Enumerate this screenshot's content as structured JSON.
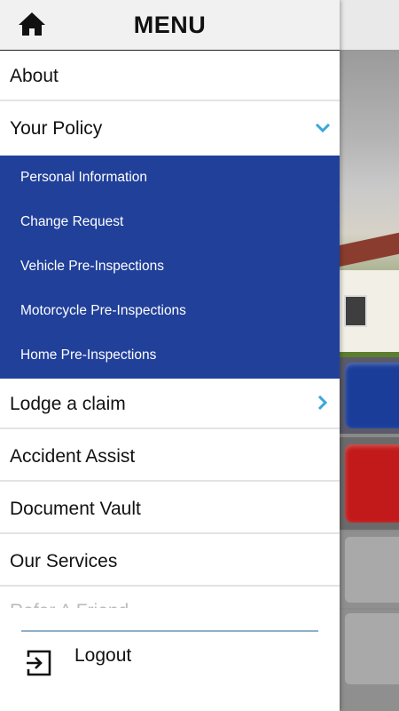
{
  "drawer": {
    "title": "MENU",
    "home_icon": "home-icon"
  },
  "menu": {
    "about": "About",
    "your_policy": "Your Policy",
    "lodge_claim": "Lodge a claim",
    "accident_assist": "Accident Assist",
    "document_vault": "Document Vault",
    "our_services": "Our Services",
    "partial_item": "Refer A Friend"
  },
  "submenu": [
    "Personal Information",
    "Change Request",
    "Vehicle Pre-Inspections",
    "Motorcycle Pre-Inspections",
    "Home Pre-Inspections"
  ],
  "logout": {
    "label": "Logout",
    "icon": "logout-icon"
  },
  "colors": {
    "submenu_bg": "#21409a",
    "chevron": "#3aa6d9",
    "tile_blue": "#1a3d9a",
    "tile_red": "#c21a1a"
  }
}
